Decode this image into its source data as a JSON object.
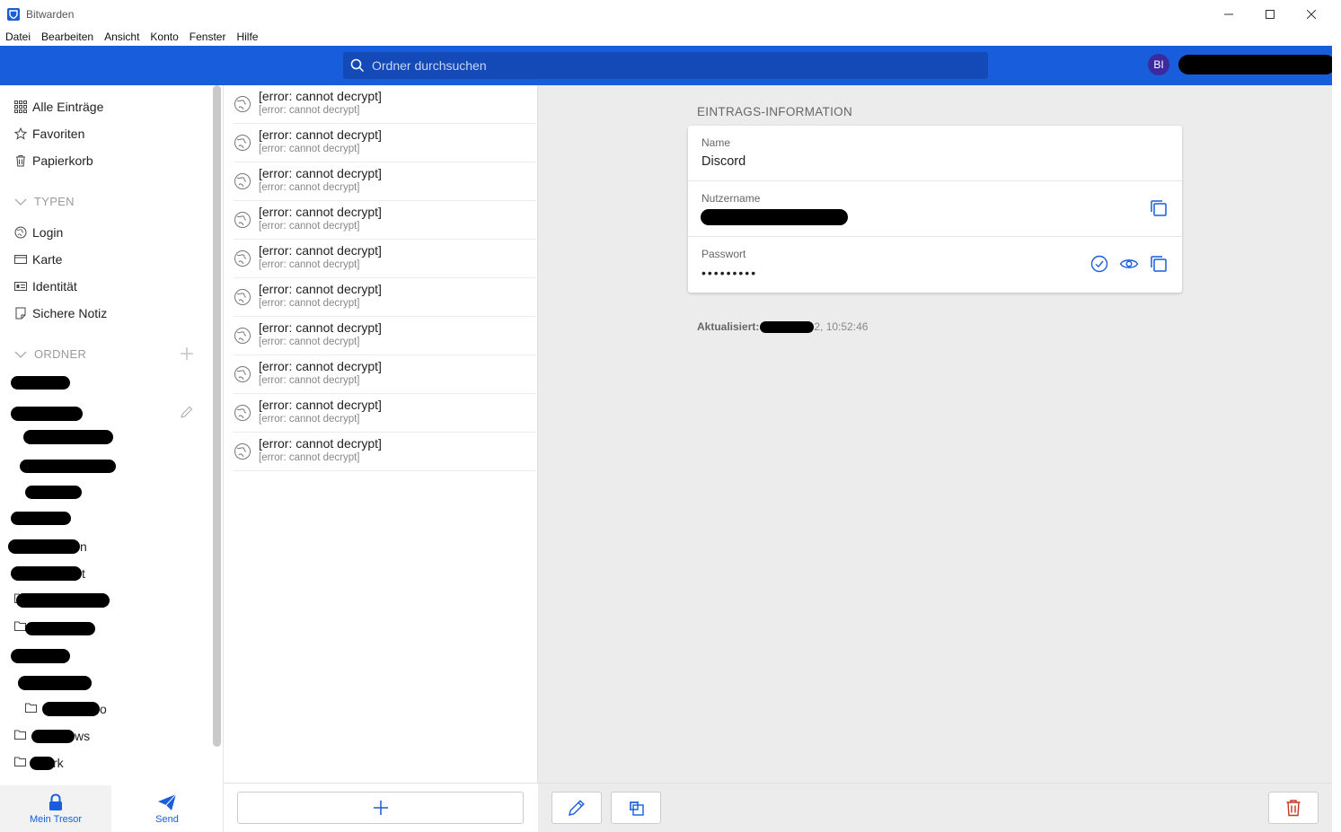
{
  "window": {
    "title": "Bitwarden"
  },
  "menu": [
    "Datei",
    "Bearbeiten",
    "Ansicht",
    "Konto",
    "Fenster",
    "Hilfe"
  ],
  "header": {
    "search_placeholder": "Ordner durchsuchen",
    "avatar_initials": "BI",
    "accent": "#175ddc"
  },
  "sidebar": {
    "filters": [
      {
        "label": "Alle Einträge",
        "icon": "grid-icon"
      },
      {
        "label": "Favoriten",
        "icon": "star-icon"
      },
      {
        "label": "Papierkorb",
        "icon": "trash-icon"
      }
    ],
    "types_heading": "TYPEN",
    "types": [
      {
        "label": "Login",
        "icon": "globe-icon"
      },
      {
        "label": "Karte",
        "icon": "card-icon"
      },
      {
        "label": "Identität",
        "icon": "id-card-icon"
      },
      {
        "label": "Sichere Notiz",
        "icon": "note-icon"
      }
    ],
    "folders_heading": "ORDNER",
    "folder_fragments": [
      "t",
      "n",
      "t",
      "o",
      "ws",
      "rk"
    ],
    "tabs": [
      {
        "label": "Mein Tresor",
        "icon": "lock-icon"
      },
      {
        "label": "Send",
        "icon": "paper-plane-icon"
      }
    ]
  },
  "list": {
    "items": [
      {
        "title": "[error: cannot decrypt]",
        "subtitle": "[error: cannot decrypt]"
      },
      {
        "title": "[error: cannot decrypt]",
        "subtitle": "[error: cannot decrypt]"
      },
      {
        "title": "[error: cannot decrypt]",
        "subtitle": "[error: cannot decrypt]"
      },
      {
        "title": "[error: cannot decrypt]",
        "subtitle": "[error: cannot decrypt]"
      },
      {
        "title": "[error: cannot decrypt]",
        "subtitle": "[error: cannot decrypt]"
      },
      {
        "title": "[error: cannot decrypt]",
        "subtitle": "[error: cannot decrypt]"
      },
      {
        "title": "[error: cannot decrypt]",
        "subtitle": "[error: cannot decrypt]"
      },
      {
        "title": "[error: cannot decrypt]",
        "subtitle": "[error: cannot decrypt]"
      },
      {
        "title": "[error: cannot decrypt]",
        "subtitle": "[error: cannot decrypt]"
      },
      {
        "title": "[error: cannot decrypt]",
        "subtitle": "[error: cannot decrypt]"
      }
    ]
  },
  "details": {
    "heading": "EINTRAGS-INFORMATION",
    "name_label": "Name",
    "name_value": "Discord",
    "username_label": "Nutzername",
    "password_label": "Passwort",
    "password_value": "•••••••••",
    "updated_label": "Aktualisiert:",
    "updated_suffix": "2, 10:52:46"
  },
  "colors": {
    "brand": "#175ddc",
    "danger": "#c83522",
    "muted": "#9a9a9a"
  }
}
